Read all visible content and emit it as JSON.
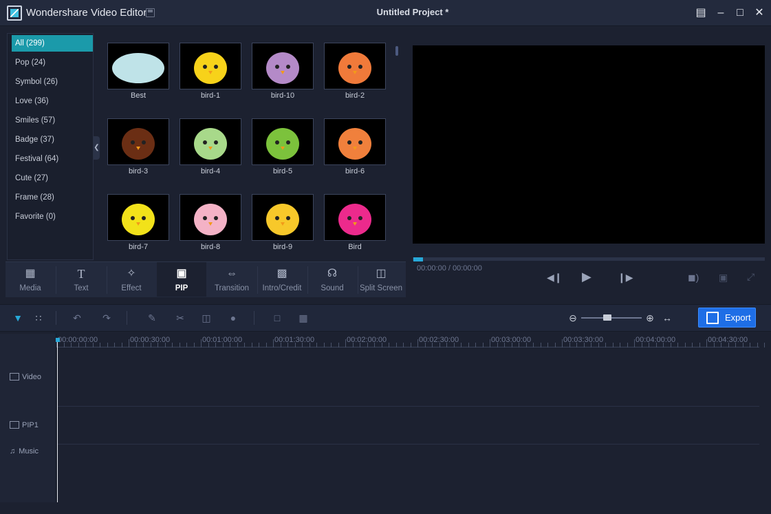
{
  "app": {
    "title": "Wondershare Video Editor",
    "project_title": "Untitled Project *"
  },
  "categories": [
    {
      "label": "All (299)",
      "active": true
    },
    {
      "label": "Pop (24)"
    },
    {
      "label": "Symbol (26)"
    },
    {
      "label": "Love (36)"
    },
    {
      "label": "Smiles (57)"
    },
    {
      "label": "Badge (37)"
    },
    {
      "label": "Festival (64)"
    },
    {
      "label": "Cute (27)"
    },
    {
      "label": "Frame (28)"
    },
    {
      "label": "Favorite (0)"
    }
  ],
  "thumbnails": [
    {
      "label": "Best",
      "color": "#bfe3e8"
    },
    {
      "label": "bird-1",
      "color": "#f7d21a"
    },
    {
      "label": "bird-10",
      "color": "#b48ac8"
    },
    {
      "label": "bird-2",
      "color": "#f07a3a"
    },
    {
      "label": "bird-3",
      "color": "#6b2e14"
    },
    {
      "label": "bird-4",
      "color": "#a8d98a"
    },
    {
      "label": "bird-5",
      "color": "#7cc23c"
    },
    {
      "label": "bird-6",
      "color": "#f0803c"
    },
    {
      "label": "bird-7",
      "color": "#f2e21a"
    },
    {
      "label": "bird-8",
      "color": "#f4b2c6"
    },
    {
      "label": "bird-9",
      "color": "#f7c82a"
    },
    {
      "label": "Bird",
      "color": "#ec2a8c"
    }
  ],
  "tabs": [
    {
      "label": "Media",
      "icon": "media-icon"
    },
    {
      "label": "Text",
      "icon": "text-icon"
    },
    {
      "label": "Effect",
      "icon": "effect-wand-icon"
    },
    {
      "label": "PIP",
      "icon": "pip-icon",
      "active": true
    },
    {
      "label": "Transition",
      "icon": "transition-icon"
    },
    {
      "label": "Intro/Credit",
      "icon": "intro-credit-icon"
    },
    {
      "label": "Sound",
      "icon": "headphones-icon"
    },
    {
      "label": "Split Screen",
      "icon": "split-screen-icon"
    }
  ],
  "player": {
    "timecode": "00:00:00 / 00:00:00"
  },
  "export": {
    "label": "Export"
  },
  "ruler": [
    "00:00:00:00",
    "00:00:30:00",
    "00:01:00:00",
    "00:01:30:00",
    "00:02:00:00",
    "00:02:30:00",
    "00:03:00:00",
    "00:03:30:00",
    "00:04:00:00",
    "00:04:30:00"
  ],
  "tracks": [
    {
      "label": "Video",
      "icon": "video-track-icon"
    },
    {
      "label": "PIP1",
      "icon": "pip-track-icon"
    },
    {
      "label": "Music",
      "icon": "music-note-icon"
    }
  ],
  "colors": {
    "accent": "#1b9aaa",
    "export": "#1e6ee6",
    "progress": "#27a8d8"
  }
}
